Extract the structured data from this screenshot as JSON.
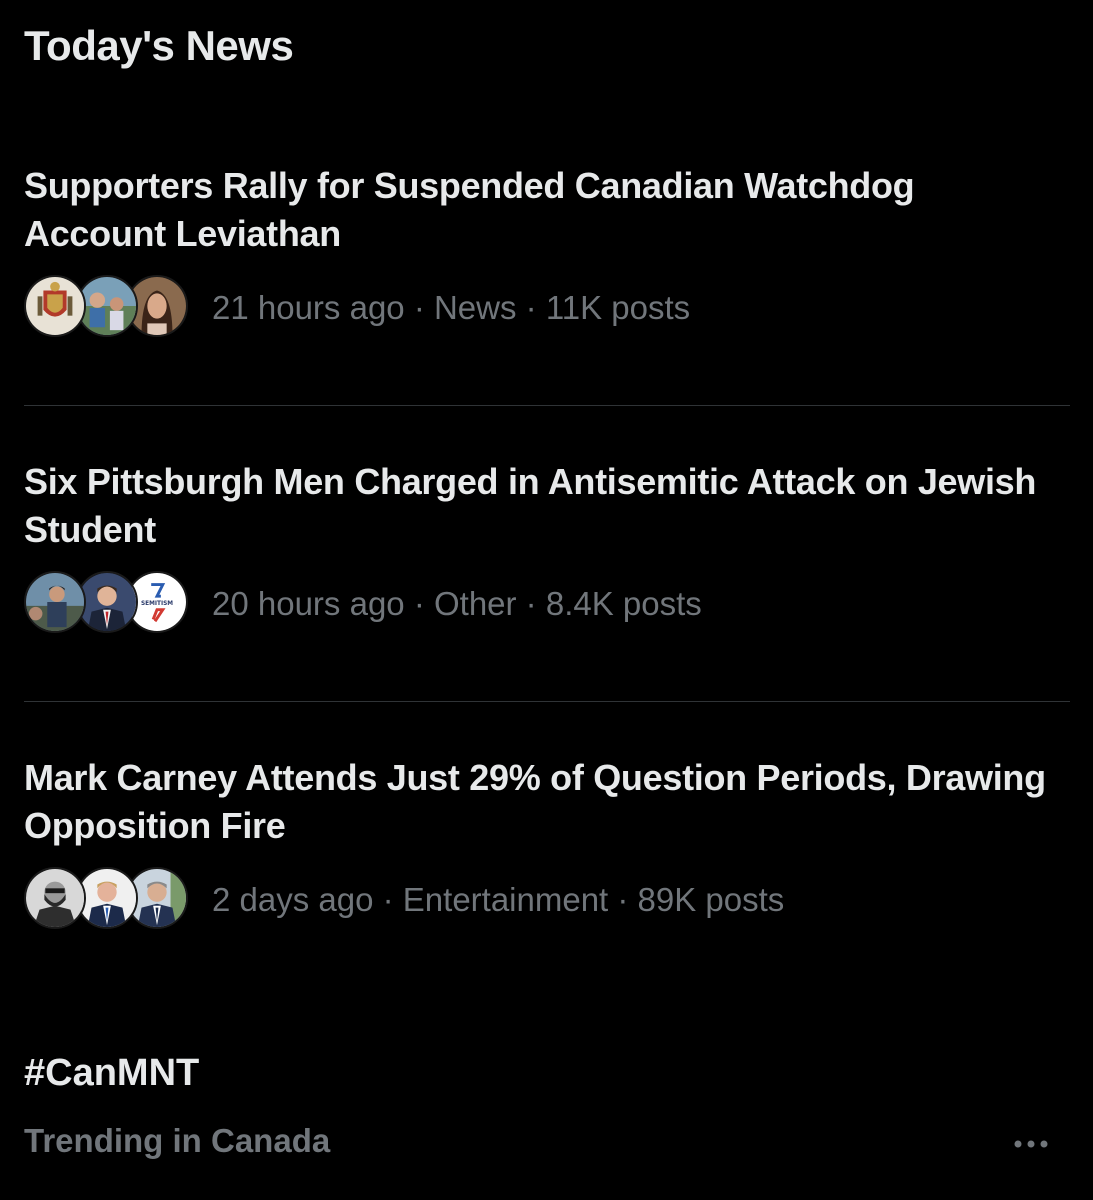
{
  "section": {
    "title": "Today's News"
  },
  "news": [
    {
      "headline": "Supporters Rally for Suspended Canadian Watchdog Account Leviathan",
      "meta": "21 hours ago · News · 11K posts",
      "avatars": [
        "crest-avatar",
        "crowd-avatar",
        "woman-avatar"
      ]
    },
    {
      "headline": "Six Pittsburgh Men Charged in Antisemitic Attack on Jewish Student",
      "meta": "20 hours ago · Other · 8.4K posts",
      "avatars": [
        "outdoor-man-avatar",
        "suit-man-avatar",
        "logo-avatar"
      ],
      "logo_text": "SEMITISM"
    },
    {
      "headline": "Mark Carney Attends Just 29% of Question Periods, Drawing Opposition Fire",
      "meta": "2 days ago · Entertainment · 89K posts",
      "avatars": [
        "bearded-man-avatar",
        "suit-man-avatar",
        "smiling-man-avatar"
      ]
    }
  ],
  "trend": {
    "tag": "#CanMNT",
    "context": "Trending in Canada",
    "more_icon": "more-horizontal-icon"
  },
  "colors": {
    "background": "#000000",
    "primary_text": "#e7e9ea",
    "secondary_text": "#71767b",
    "divider": "#2f3336"
  }
}
